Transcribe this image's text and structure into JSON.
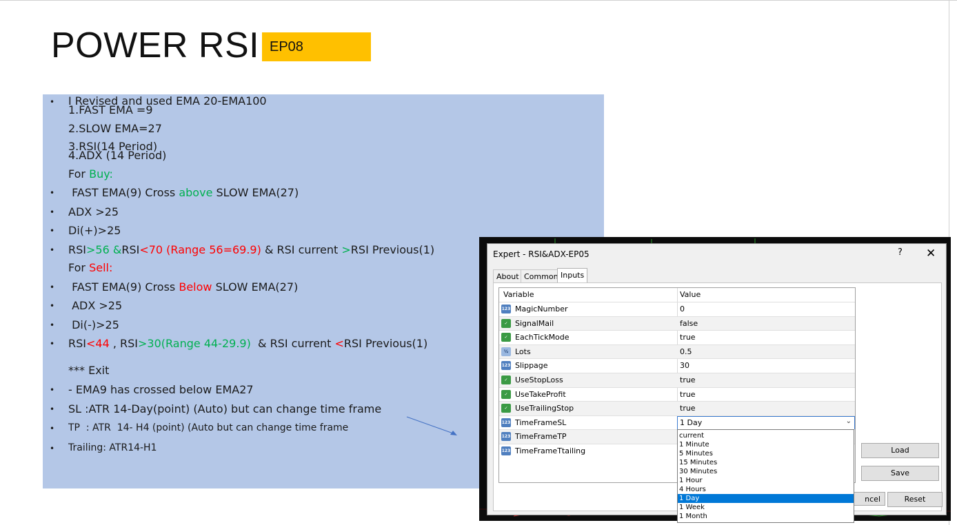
{
  "slide": {
    "title": "POWER RSI",
    "badge": "EP08"
  },
  "notes": {
    "intro": "I Revised and used EMA 20-EMA100",
    "params": [
      "1.FAST EMA =9",
      "2.SLOW EMA=27",
      "3.RSI(14 Period)",
      "4.ADX (14 Period)"
    ],
    "buy_heading": "For ",
    "buy_word": "Buy:",
    "buy_rule1": {
      "a": " FAST EMA(9) Cross ",
      "b": "above",
      "c": " SLOW EMA(27)"
    },
    "buy_rule2": "ADX >25",
    "buy_rule3": "Di(+)>25",
    "buy_rule4": {
      "a": "RSI",
      "b": ">56 &",
      "c": "RSI",
      "d": "<70 (Range 56=69.9)",
      "e": " & RSI current ",
      "f": ">",
      "g": "RSI Previous(1)"
    },
    "sell_heading": "For ",
    "sell_word": "Sell:",
    "sell_rule1": {
      "a": " FAST EMA(9) Cross ",
      "b": "Below",
      "c": " SLOW EMA(27)"
    },
    "sell_rule2": " ADX >25",
    "sell_rule3": " Di(-)>25",
    "sell_rule4": {
      "a": "RSI",
      "b": "<44",
      "c": " , RSI",
      "d": ">30(Range 44-29.9)",
      "e": "  & RSI current ",
      "f": "<",
      "g": "RSI Previous(1)"
    },
    "exit_heading": "*** Exit",
    "exit_rule1": "- EMA9 has crossed below EMA27",
    "sl": "SL :ATR 14-Day(point) (Auto) but can change time frame",
    "tp": "TP  : ATR  14- H4 (point) (Auto but can change time frame",
    "trailing": "Trailing: ATR14-H1"
  },
  "dialog": {
    "title": "Expert - RSI&ADX-EP05",
    "help": "?",
    "close": "✕",
    "tabs": [
      "About",
      "Common",
      "Inputs"
    ],
    "active_tab": "Inputs",
    "columns": [
      "Variable",
      "Value"
    ],
    "inputs": [
      {
        "name": "MagicNumber",
        "value": "0",
        "icon": "123"
      },
      {
        "name": "SignalMail",
        "value": "false",
        "icon": "bool"
      },
      {
        "name": "EachTickMode",
        "value": "true",
        "icon": "bool"
      },
      {
        "name": "Lots",
        "value": "0.5",
        "icon": "½"
      },
      {
        "name": "Slippage",
        "value": "30",
        "icon": "123"
      },
      {
        "name": "UseStopLoss",
        "value": "true",
        "icon": "bool"
      },
      {
        "name": "UseTakeProfit",
        "value": "true",
        "icon": "bool"
      },
      {
        "name": "UseTrailingStop",
        "value": "true",
        "icon": "bool"
      },
      {
        "name": "TimeFrameSL",
        "value": "1 Day",
        "icon": "123"
      },
      {
        "name": "TimeFrameTP",
        "value": "",
        "icon": "123"
      },
      {
        "name": "TimeFrameTtailing",
        "value": "",
        "icon": "123"
      }
    ],
    "dropdown_options": [
      "current",
      "1 Minute",
      "5 Minutes",
      "15 Minutes",
      "30 Minutes",
      "1 Hour",
      "4 Hours",
      "1 Day",
      "1 Week",
      "1 Month"
    ],
    "dropdown_selected": "1 Day",
    "buttons": {
      "load": "Load",
      "save": "Save",
      "cancel": "ncel",
      "reset": "Reset"
    }
  },
  "colors": {
    "panel": "#b4c7e7",
    "badge": "#ffc000",
    "green": "#00b050",
    "red": "#ff0000",
    "selection": "#0078d7"
  }
}
